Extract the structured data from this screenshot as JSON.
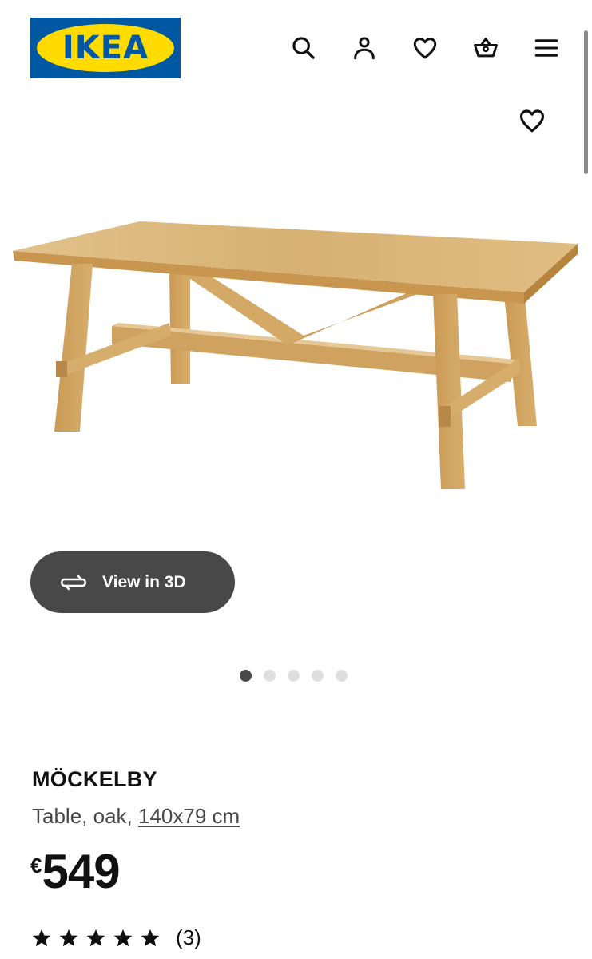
{
  "header": {
    "logo_text": "IKEA",
    "icons": [
      "search-icon",
      "user-icon",
      "heart-icon",
      "basket-icon",
      "menu-icon"
    ]
  },
  "colors": {
    "brand_blue": "#0058a3",
    "brand_yellow": "#ffdb00",
    "button_dark": "#484848",
    "wood": "#d9b77a"
  },
  "gallery": {
    "view3d_label": "View in 3D",
    "image_count": 5,
    "active_index": 0
  },
  "product": {
    "name": "MÖCKELBY",
    "description": "Table, oak,",
    "dimensions": "140x79 cm",
    "currency": "€",
    "price": "549",
    "rating": 5,
    "review_count": "(3)"
  }
}
